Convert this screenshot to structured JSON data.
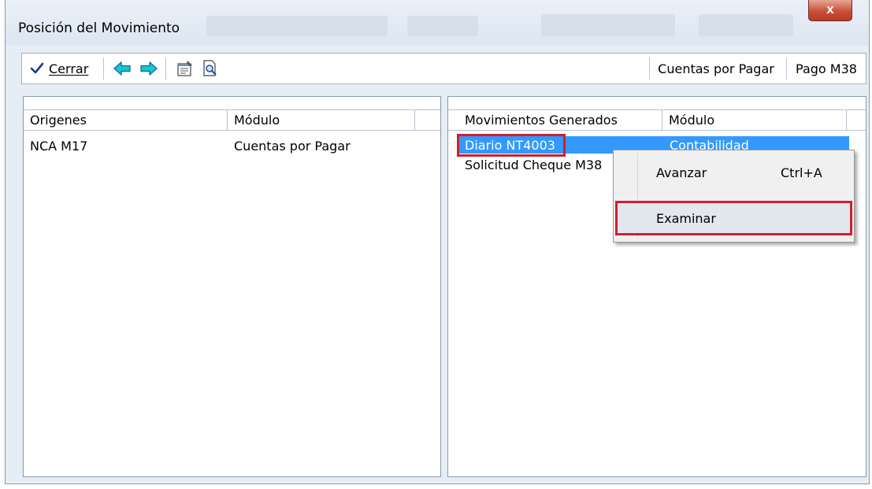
{
  "window": {
    "title": "Posición del Movimiento",
    "close_label": "x"
  },
  "toolbar": {
    "close_label": "Cerrar",
    "module_button": "Cuentas por Pagar",
    "movement_button": "Pago M38"
  },
  "origins_panel": {
    "columns": [
      "Origenes",
      "Módulo"
    ],
    "rows": [
      {
        "name": "NCA M17",
        "module": "Cuentas por Pagar"
      }
    ]
  },
  "generated_panel": {
    "columns": [
      "Movimientos Generados",
      "Módulo"
    ],
    "rows": [
      {
        "name": "Diario NT4003",
        "module": "Contabilidad",
        "selected": true
      },
      {
        "name": "Solicitud Cheque M38",
        "module": ""
      }
    ]
  },
  "context_menu": {
    "items": [
      {
        "label": "Avanzar",
        "shortcut": "Ctrl+A"
      },
      {
        "label": "Examinar",
        "shortcut": ""
      }
    ]
  },
  "colors": {
    "selection": "#3399ff",
    "highlight_box": "#d0202c",
    "arrow_icon": "#19c3d8",
    "check_icon": "#1a3a8c"
  }
}
